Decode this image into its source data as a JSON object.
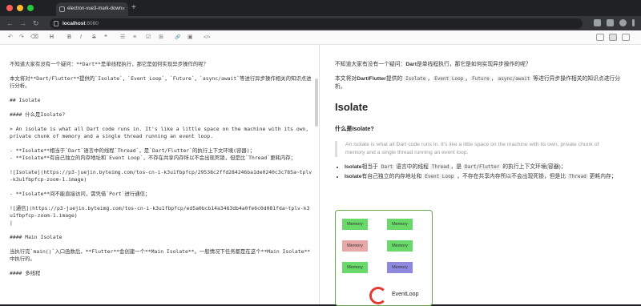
{
  "browser": {
    "tab_title": "electron-vue3-mark-down",
    "tab_close": "×",
    "new_tab": "+",
    "back": "←",
    "forward": "→",
    "reload": "↻",
    "url_host": "localhost",
    "url_port": ":8080"
  },
  "toolbar": {
    "undo": "↶",
    "redo": "↷",
    "clear": "⌫",
    "heading": "H",
    "bold": "B",
    "italic": "I",
    "strike": "S",
    "quote": "❝",
    "ul": "☰",
    "ol": "≡",
    "checklist": "☑",
    "table": "⊞",
    "link": "🔗",
    "image": "▣",
    "code": "</>"
  },
  "editor": {
    "lines": [
      "不知道大家有没有一个疑问：**Dart**是单线程执行，那它是如何实现异步操作的呢？",
      "本文将对**Dart/Flutter**提供的`Isolate`，`Event Loop`，`Future`，`async/await`等进行异步操作相关的知识点进行分析。",
      "## Isolate",
      "#### 什么是Isolate?",
      "> An isolate is what all Dart code runs in. It's like a little space on the machine with its own, private chunk of memory and a single thread running an event loop.",
      "- **Isolate**相当于`Dart`语言中的线程`Thread`，是`Dart/Flutter`的执行上下文环境(容器)；\n- **Isolate**有自己独立的内存地址和`Event Loop`，不存在共享内存所以不会出现死锁，但是比`Thread`更耗内存；",
      "![Isolate](https://p3-juejin.byteimg.com/tos-cn-i-k3u1fbpfcp/29538c2ffd284246ba1de0240c3c785a~tplv-k3u1fbpfcp-zoom-1.image)",
      "- **Isolate**间不能直接访问，需凭借`Port`进行通信；",
      "![通信](https://p3-juejin.byteimg.com/tos-cn-i-k3u1fbpfcp/ed5a0bcb14a3463db4a0fe6c0d081fda~tplv-k3u1fbpfcp-zoom-1.image)\n|",
      "#### Main Isolate",
      "当执行完`main()`入口函数后，**Flutter**会创建一个**Main Isolate**。一般情况下任务都是在这个**Main Isolate**中执行的。",
      "#### 多线程"
    ]
  },
  "preview": {
    "intro_pre": "不知道大家有没有一个疑问：",
    "intro_bold": "Dart",
    "intro_post": "是单线程执行，那它是如何实现异步操作的呢？",
    "p2_pre": "本文将对",
    "p2_bold": "Dart/Flutter",
    "p2_mid": "提供的 ",
    "c1": "Isolate",
    "sep1": "，",
    "c2": "Event Loop",
    "sep2": "，",
    "c3": "Future",
    "sep3": "，",
    "c4": "async/await",
    "p2_post": " 等进行异步操作相关的知识点进行分析。",
    "h2": "Isolate",
    "h4": "什么是Isolate?",
    "quote": "An isolate is what all Dart code runs in. It's like a little space on the machine with its own, private chunk of memory and a single thread running an event loop.",
    "li1_bold": "Isolate",
    "li1_a": "相当于 ",
    "li1_c1": "Dart",
    "li1_b": " 语言中的线程 ",
    "li1_c2": "Thread",
    "li1_c": "，是 ",
    "li1_c3": "Dart/Flutter",
    "li1_d": " 的执行上下文环境(容器)；",
    "li2_bold": "Isolate",
    "li2_a": "有自己独立的内存地址和 ",
    "li2_c1": "Event Loop",
    "li2_b": " ，不存在共享内存所以不会出现死锁，但是比 ",
    "li2_c2": "Thread",
    "li2_c": " 更耗内存；",
    "diagram": {
      "memory": "Memory",
      "eventloop": "EventLoop"
    }
  }
}
